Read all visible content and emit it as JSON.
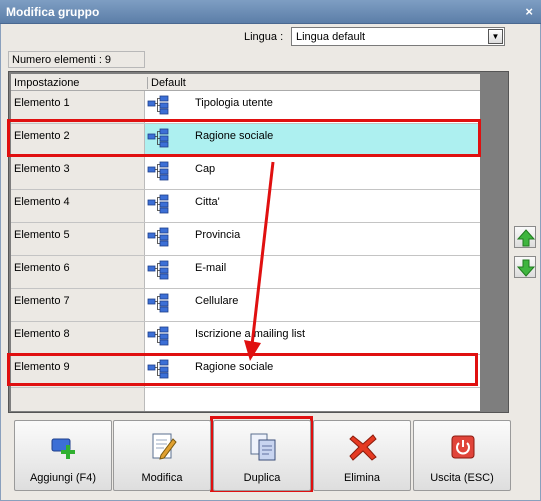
{
  "window": {
    "title": "Modifica gruppo",
    "close": "×"
  },
  "lingua": {
    "label": "Lingua :",
    "value": "Lingua default",
    "arrow": "▼"
  },
  "count": "Numero elementi : 9",
  "grid": {
    "headers": [
      "Impostazione",
      "Default"
    ],
    "rows": [
      {
        "name": "Elemento 1",
        "value": "Tipologia utente"
      },
      {
        "name": "Elemento 2",
        "value": "Ragione sociale"
      },
      {
        "name": "Elemento 3",
        "value": "Cap"
      },
      {
        "name": "Elemento 4",
        "value": "Citta'"
      },
      {
        "name": "Elemento 5",
        "value": "Provincia"
      },
      {
        "name": "Elemento 6",
        "value": "E-mail"
      },
      {
        "name": "Elemento 7",
        "value": "Cellulare"
      },
      {
        "name": "Elemento 8",
        "value": "Iscrizione a mailing list"
      },
      {
        "name": "Elemento 9",
        "value": "Ragione sociale"
      }
    ],
    "selected_row": 2
  },
  "buttons": {
    "aggiungi": "Aggiungi (F4)",
    "modifica": "Modifica",
    "duplica": "Duplica",
    "elimina": "Elimina",
    "uscita": "Uscita (ESC)"
  },
  "colors": {
    "highlight": "#e01010",
    "selected_row": "#adf0f0",
    "titlebar": "#6a8bb5"
  },
  "icons": {
    "row": "tree-node-icon",
    "up": "arrow-up-icon",
    "down": "arrow-down-icon",
    "aggiungi": "add-icon",
    "modifica": "edit-document-icon",
    "duplica": "duplicate-icon",
    "elimina": "delete-x-icon",
    "uscita": "power-icon"
  }
}
